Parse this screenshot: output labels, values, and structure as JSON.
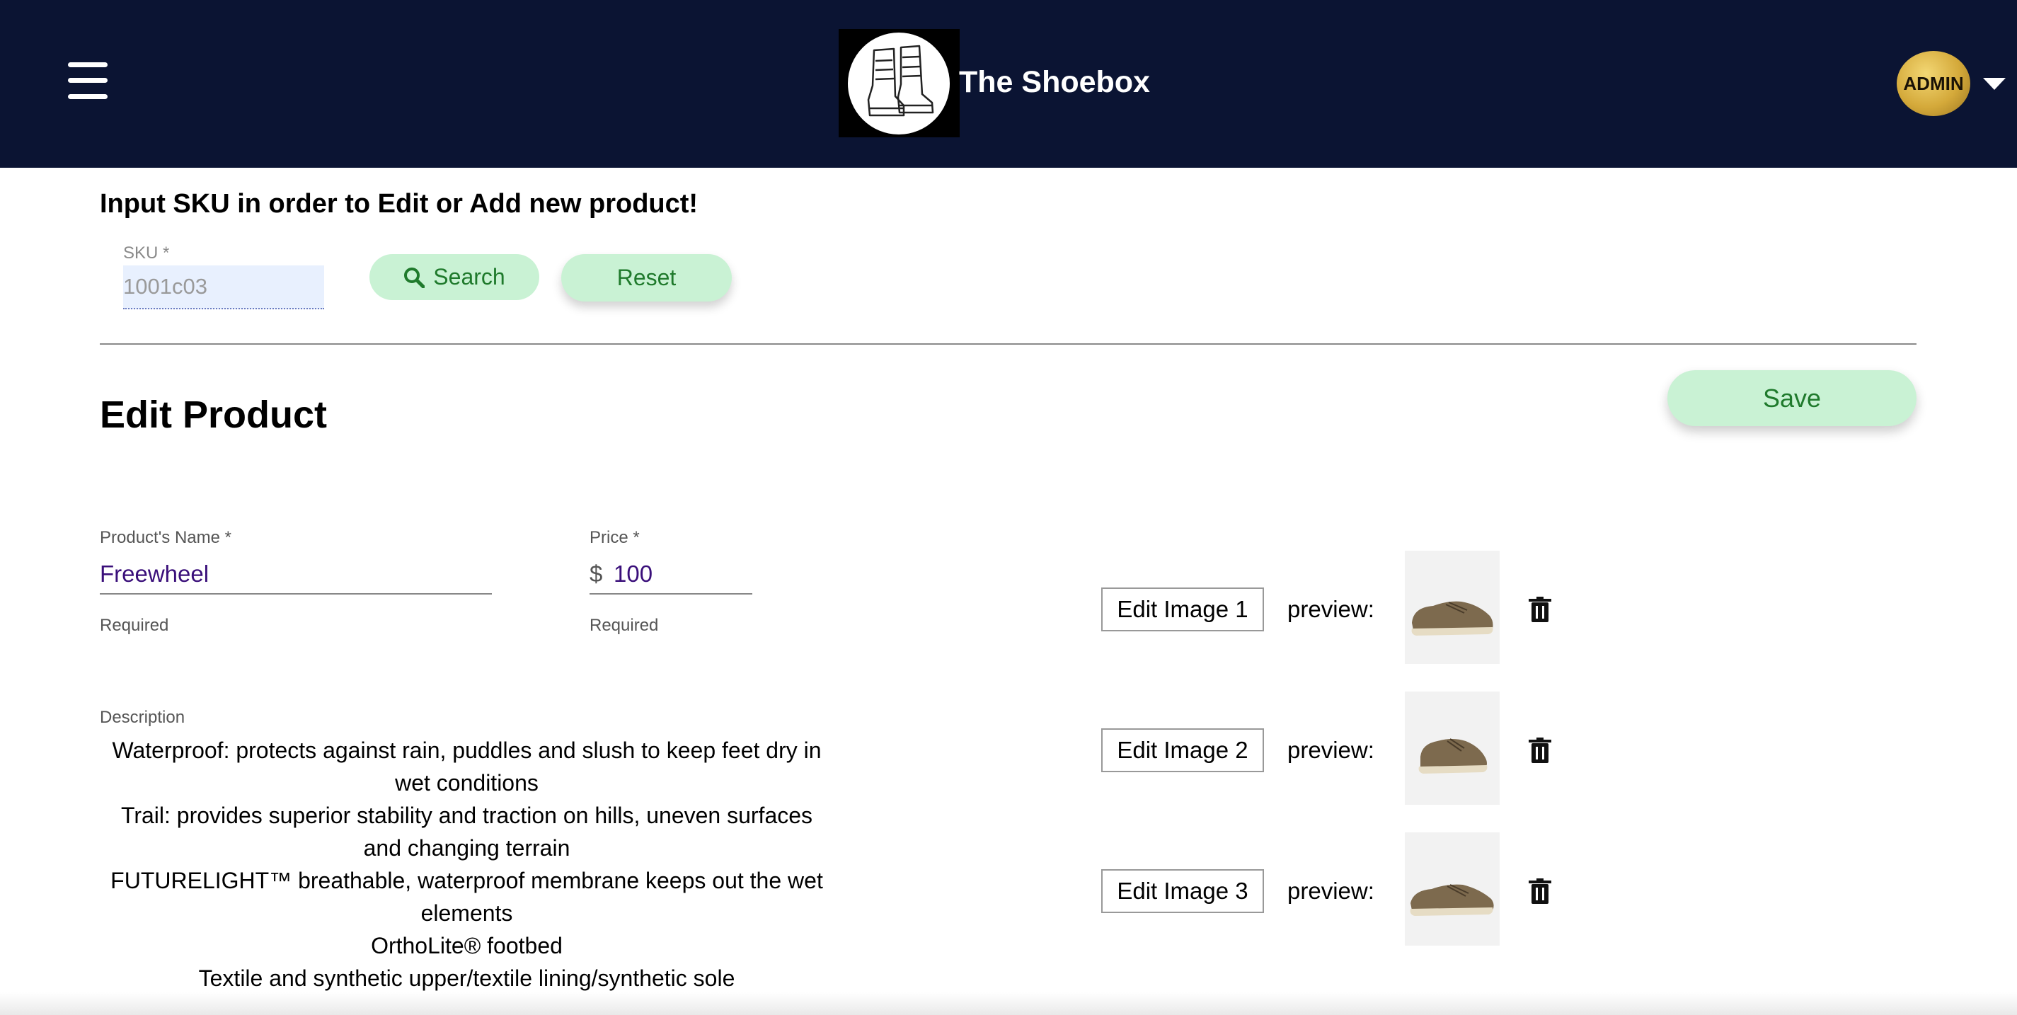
{
  "header": {
    "brand": "The Shoebox",
    "menu_icon": "hamburger-menu-icon",
    "logo_icon": "boots-logo-icon",
    "user_badge": "ADMIN",
    "dropdown_icon": "caret-down-icon",
    "background_color": "#0b1433"
  },
  "sku_section": {
    "title": "Input SKU in order to Edit or Add new product!",
    "sku_label": "SKU *",
    "sku_value": "1001c03",
    "search_label": "Search",
    "search_icon": "search-icon",
    "reset_label": "Reset"
  },
  "edit": {
    "title": "Edit Product",
    "save_label": "Save",
    "name_label": "Product's Name *",
    "name_value": "Freewheel",
    "name_helper": "Required",
    "price_label": "Price *",
    "price_prefix": "$",
    "price_value": "100",
    "price_helper": "Required",
    "description_label": "Description",
    "description_lines": [
      "Waterproof: protects against rain, puddles and slush to keep feet dry in wet conditions",
      "Trail: provides superior stability and traction on hills, uneven surfaces and changing terrain",
      "FUTURELIGHT™ breathable, waterproof membrane keeps out the wet elements",
      "OrthoLite® footbed",
      "Textile and synthetic upper/textile lining/synthetic sole"
    ]
  },
  "images": [
    {
      "button_label": "Edit Image 1",
      "preview_label": "preview:",
      "delete_icon": "trash-icon"
    },
    {
      "button_label": "Edit Image 2",
      "preview_label": "preview:",
      "delete_icon": "trash-icon"
    },
    {
      "button_label": "Edit Image 3",
      "preview_label": "preview:",
      "delete_icon": "trash-icon"
    }
  ],
  "colors": {
    "accent_button_bg": "#c9f2d4",
    "accent_button_text": "#1f7a2c",
    "field_text": "#3a0f7a"
  }
}
